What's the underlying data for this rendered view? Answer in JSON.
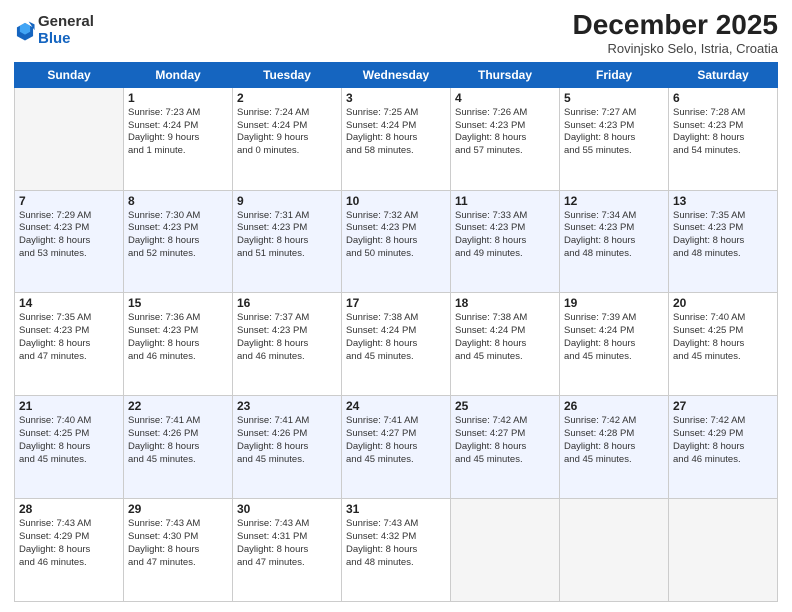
{
  "header": {
    "logo_general": "General",
    "logo_blue": "Blue",
    "month_title": "December 2025",
    "subtitle": "Rovinjsko Selo, Istria, Croatia"
  },
  "days_of_week": [
    "Sunday",
    "Monday",
    "Tuesday",
    "Wednesday",
    "Thursday",
    "Friday",
    "Saturday"
  ],
  "weeks": [
    {
      "row_class": "row-odd",
      "days": [
        {
          "num": "",
          "info": "",
          "empty": true
        },
        {
          "num": "1",
          "info": "Sunrise: 7:23 AM\nSunset: 4:24 PM\nDaylight: 9 hours\nand 1 minute."
        },
        {
          "num": "2",
          "info": "Sunrise: 7:24 AM\nSunset: 4:24 PM\nDaylight: 9 hours\nand 0 minutes."
        },
        {
          "num": "3",
          "info": "Sunrise: 7:25 AM\nSunset: 4:24 PM\nDaylight: 8 hours\nand 58 minutes."
        },
        {
          "num": "4",
          "info": "Sunrise: 7:26 AM\nSunset: 4:23 PM\nDaylight: 8 hours\nand 57 minutes."
        },
        {
          "num": "5",
          "info": "Sunrise: 7:27 AM\nSunset: 4:23 PM\nDaylight: 8 hours\nand 55 minutes."
        },
        {
          "num": "6",
          "info": "Sunrise: 7:28 AM\nSunset: 4:23 PM\nDaylight: 8 hours\nand 54 minutes."
        }
      ]
    },
    {
      "row_class": "row-even",
      "days": [
        {
          "num": "7",
          "info": "Sunrise: 7:29 AM\nSunset: 4:23 PM\nDaylight: 8 hours\nand 53 minutes."
        },
        {
          "num": "8",
          "info": "Sunrise: 7:30 AM\nSunset: 4:23 PM\nDaylight: 8 hours\nand 52 minutes."
        },
        {
          "num": "9",
          "info": "Sunrise: 7:31 AM\nSunset: 4:23 PM\nDaylight: 8 hours\nand 51 minutes."
        },
        {
          "num": "10",
          "info": "Sunrise: 7:32 AM\nSunset: 4:23 PM\nDaylight: 8 hours\nand 50 minutes."
        },
        {
          "num": "11",
          "info": "Sunrise: 7:33 AM\nSunset: 4:23 PM\nDaylight: 8 hours\nand 49 minutes."
        },
        {
          "num": "12",
          "info": "Sunrise: 7:34 AM\nSunset: 4:23 PM\nDaylight: 8 hours\nand 48 minutes."
        },
        {
          "num": "13",
          "info": "Sunrise: 7:35 AM\nSunset: 4:23 PM\nDaylight: 8 hours\nand 48 minutes."
        }
      ]
    },
    {
      "row_class": "row-odd",
      "days": [
        {
          "num": "14",
          "info": "Sunrise: 7:35 AM\nSunset: 4:23 PM\nDaylight: 8 hours\nand 47 minutes."
        },
        {
          "num": "15",
          "info": "Sunrise: 7:36 AM\nSunset: 4:23 PM\nDaylight: 8 hours\nand 46 minutes."
        },
        {
          "num": "16",
          "info": "Sunrise: 7:37 AM\nSunset: 4:23 PM\nDaylight: 8 hours\nand 46 minutes."
        },
        {
          "num": "17",
          "info": "Sunrise: 7:38 AM\nSunset: 4:24 PM\nDaylight: 8 hours\nand 45 minutes."
        },
        {
          "num": "18",
          "info": "Sunrise: 7:38 AM\nSunset: 4:24 PM\nDaylight: 8 hours\nand 45 minutes."
        },
        {
          "num": "19",
          "info": "Sunrise: 7:39 AM\nSunset: 4:24 PM\nDaylight: 8 hours\nand 45 minutes."
        },
        {
          "num": "20",
          "info": "Sunrise: 7:40 AM\nSunset: 4:25 PM\nDaylight: 8 hours\nand 45 minutes."
        }
      ]
    },
    {
      "row_class": "row-even",
      "days": [
        {
          "num": "21",
          "info": "Sunrise: 7:40 AM\nSunset: 4:25 PM\nDaylight: 8 hours\nand 45 minutes."
        },
        {
          "num": "22",
          "info": "Sunrise: 7:41 AM\nSunset: 4:26 PM\nDaylight: 8 hours\nand 45 minutes."
        },
        {
          "num": "23",
          "info": "Sunrise: 7:41 AM\nSunset: 4:26 PM\nDaylight: 8 hours\nand 45 minutes."
        },
        {
          "num": "24",
          "info": "Sunrise: 7:41 AM\nSunset: 4:27 PM\nDaylight: 8 hours\nand 45 minutes."
        },
        {
          "num": "25",
          "info": "Sunrise: 7:42 AM\nSunset: 4:27 PM\nDaylight: 8 hours\nand 45 minutes."
        },
        {
          "num": "26",
          "info": "Sunrise: 7:42 AM\nSunset: 4:28 PM\nDaylight: 8 hours\nand 45 minutes."
        },
        {
          "num": "27",
          "info": "Sunrise: 7:42 AM\nSunset: 4:29 PM\nDaylight: 8 hours\nand 46 minutes."
        }
      ]
    },
    {
      "row_class": "row-odd",
      "days": [
        {
          "num": "28",
          "info": "Sunrise: 7:43 AM\nSunset: 4:29 PM\nDaylight: 8 hours\nand 46 minutes."
        },
        {
          "num": "29",
          "info": "Sunrise: 7:43 AM\nSunset: 4:30 PM\nDaylight: 8 hours\nand 47 minutes."
        },
        {
          "num": "30",
          "info": "Sunrise: 7:43 AM\nSunset: 4:31 PM\nDaylight: 8 hours\nand 47 minutes."
        },
        {
          "num": "31",
          "info": "Sunrise: 7:43 AM\nSunset: 4:32 PM\nDaylight: 8 hours\nand 48 minutes."
        },
        {
          "num": "",
          "info": "",
          "empty": true
        },
        {
          "num": "",
          "info": "",
          "empty": true
        },
        {
          "num": "",
          "info": "",
          "empty": true
        }
      ]
    }
  ]
}
